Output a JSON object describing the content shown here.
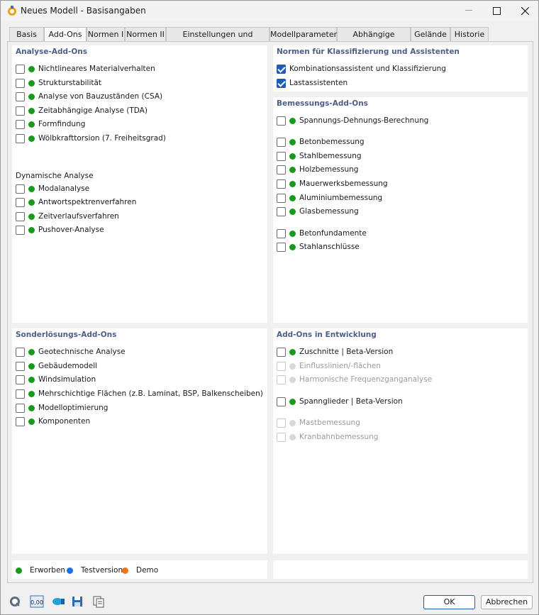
{
  "window": {
    "title": "Neues Modell - Basisangaben"
  },
  "tabs": [
    {
      "label": "Basis",
      "active": false
    },
    {
      "label": "Add-Ons",
      "active": true
    },
    {
      "label": "Normen I",
      "active": false
    },
    {
      "label": "Normen II",
      "active": false
    },
    {
      "label": "Einstellungen und Optionen",
      "active": false
    },
    {
      "label": "Modellparameter",
      "active": false
    },
    {
      "label": "Abhängige Modelle",
      "active": false
    },
    {
      "label": "Gelände",
      "active": false
    },
    {
      "label": "Historie",
      "active": false
    }
  ],
  "analyse": {
    "title": "Analyse-Add-Ons",
    "items": [
      {
        "label": "Nichtlineares Materialverhalten"
      },
      {
        "label": "Strukturstabilität"
      },
      {
        "label": "Analyse von Bauzuständen (CSA)"
      },
      {
        "label": "Zeitabhängige Analyse (TDA)"
      },
      {
        "label": "Formfindung"
      },
      {
        "label": "Wölbkrafttorsion (7. Freiheitsgrad)"
      }
    ],
    "dyn_title": "Dynamische Analyse",
    "dyn_items": [
      {
        "label": "Modalanalyse"
      },
      {
        "label": "Antwortspektrenverfahren"
      },
      {
        "label": "Zeitverlaufsverfahren"
      },
      {
        "label": "Pushover-Analyse"
      }
    ]
  },
  "normen": {
    "title": "Normen für Klassifizierung und Assistenten",
    "items": [
      {
        "label": "Kombinationsassistent und Klassifizierung",
        "checked": true
      },
      {
        "label": "Lastassistenten",
        "checked": true
      }
    ]
  },
  "bemessung": {
    "title": "Bemessungs-Add-Ons",
    "items": [
      {
        "label": "Spannungs-Dehnungs-Berechnung"
      },
      {
        "label": "Betonbemessung"
      },
      {
        "label": "Stahlbemessung"
      },
      {
        "label": "Holzbemessung"
      },
      {
        "label": "Mauerwerksbemessung"
      },
      {
        "label": "Aluminiumbemessung"
      },
      {
        "label": "Glasbemessung"
      },
      {
        "label": "Betonfundamente"
      },
      {
        "label": "Stahlanschlüsse"
      }
    ]
  },
  "sonder": {
    "title": "Sonderlösungs-Add-Ons",
    "items": [
      {
        "label": "Geotechnische Analyse"
      },
      {
        "label": "Gebäudemodell"
      },
      {
        "label": "Windsimulation"
      },
      {
        "label": "Mehrschichtige Flächen (z.B. Laminat, BSP, Balkenscheiben)"
      },
      {
        "label": "Modelloptimierung"
      },
      {
        "label": "Komponenten"
      }
    ]
  },
  "entwicklung": {
    "title": "Add-Ons in Entwicklung",
    "items": [
      {
        "label": "Zuschnitte | Beta-Version",
        "enabled": true
      },
      {
        "label": "Einflusslinien/-flächen",
        "enabled": false
      },
      {
        "label": "Harmonische Frequenzganganalyse",
        "enabled": false
      },
      {
        "label": "Spannglieder | Beta-Version",
        "enabled": true
      },
      {
        "label": "Mastbemessung",
        "enabled": false
      },
      {
        "label": "Kranbahnbemessung",
        "enabled": false
      }
    ]
  },
  "legend": {
    "erworben": "Erworben",
    "testversion": "Testversion",
    "demo": "Demo"
  },
  "colors": {
    "green": "#1a9a1a",
    "blue": "#1e6fe8",
    "orange": "#f2731c",
    "accent": "#4b5f86"
  },
  "toolbar": {
    "icons": [
      "help-icon",
      "units-icon",
      "model-icon",
      "save-icon",
      "copy-icon"
    ],
    "units_label": "0,00"
  },
  "buttons": {
    "ok": "OK",
    "cancel": "Abbrechen"
  }
}
